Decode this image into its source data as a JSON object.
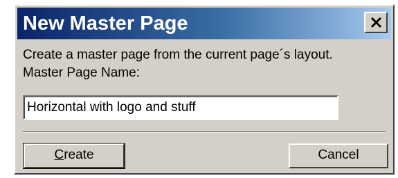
{
  "dialog": {
    "title": "New Master Page",
    "description": "Create a master page from the current page´s layout.",
    "name_label": "Master Page Name:",
    "name_value": "Horizontal with logo and stuff",
    "create_accel": "C",
    "create_rest": "reate",
    "cancel_label": "Cancel",
    "close_icon": "close-icon"
  },
  "colors": {
    "titlebar_start": "#0a246a",
    "titlebar_end": "#a6caf0",
    "dialog_face": "#d4d0c8"
  }
}
